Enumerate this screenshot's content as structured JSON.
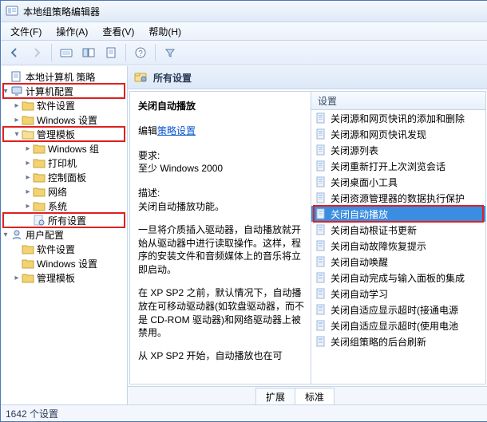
{
  "title": "本地组策略编辑器",
  "menus": [
    "文件(F)",
    "操作(A)",
    "查看(V)",
    "帮助(H)"
  ],
  "tree": {
    "root": "本地计算机 策略",
    "computer_config": "计算机配置",
    "computer_children": [
      "软件设置",
      "Windows 设置"
    ],
    "admin_templates": "管理模板",
    "admin_children": [
      "Windows 组",
      "打印机",
      "控制面板",
      "网络",
      "系统",
      "所有设置"
    ],
    "user_config": "用户配置",
    "user_children": [
      "软件设置",
      "Windows 设置",
      "管理模板"
    ]
  },
  "right_header": "所有设置",
  "column_header": "设置",
  "detail": {
    "title": "关闭自动播放",
    "edit_link": "策略设置",
    "edit_prefix": "编辑",
    "req_label": "要求:",
    "req_value": "至少 Windows 2000",
    "desc_label": "描述:",
    "desc_1": "关闭自动播放功能。",
    "desc_2": "一旦将介质插入驱动器，自动播放就开始从驱动器中进行读取操作。这样，程序的安装文件和音频媒体上的音乐将立即启动。",
    "desc_3": "在 XP SP2 之前，默认情况下，自动播放在可移动驱动器(如软盘驱动器，而不是 CD-ROM 驱动器)和网络驱动器上被禁用。",
    "desc_4": "从 XP SP2 开始，自动播放也在可"
  },
  "settings": [
    "关闭源和网页快讯的添加和删除",
    "关闭源和网页快讯发现",
    "关闭源列表",
    "关闭重新打开上次浏览会话",
    "关闭桌面小工具",
    "关闭资源管理器的数据执行保护",
    "关闭自动播放",
    "关闭自动根证书更新",
    "关闭自动故障恢复提示",
    "关闭自动唤醒",
    "关闭自动完成与输入面板的集成",
    "关闭自动学习",
    "关闭自适应显示超时(接通电源",
    "关闭自适应显示超时(使用电池",
    "关闭组策略的后台刷新"
  ],
  "selected_index": 6,
  "tabs": {
    "extended": "扩展",
    "standard": "标准"
  },
  "status": "1642 个设置",
  "colors": {
    "accent": "#3a8de0",
    "hl": "#e02020"
  }
}
